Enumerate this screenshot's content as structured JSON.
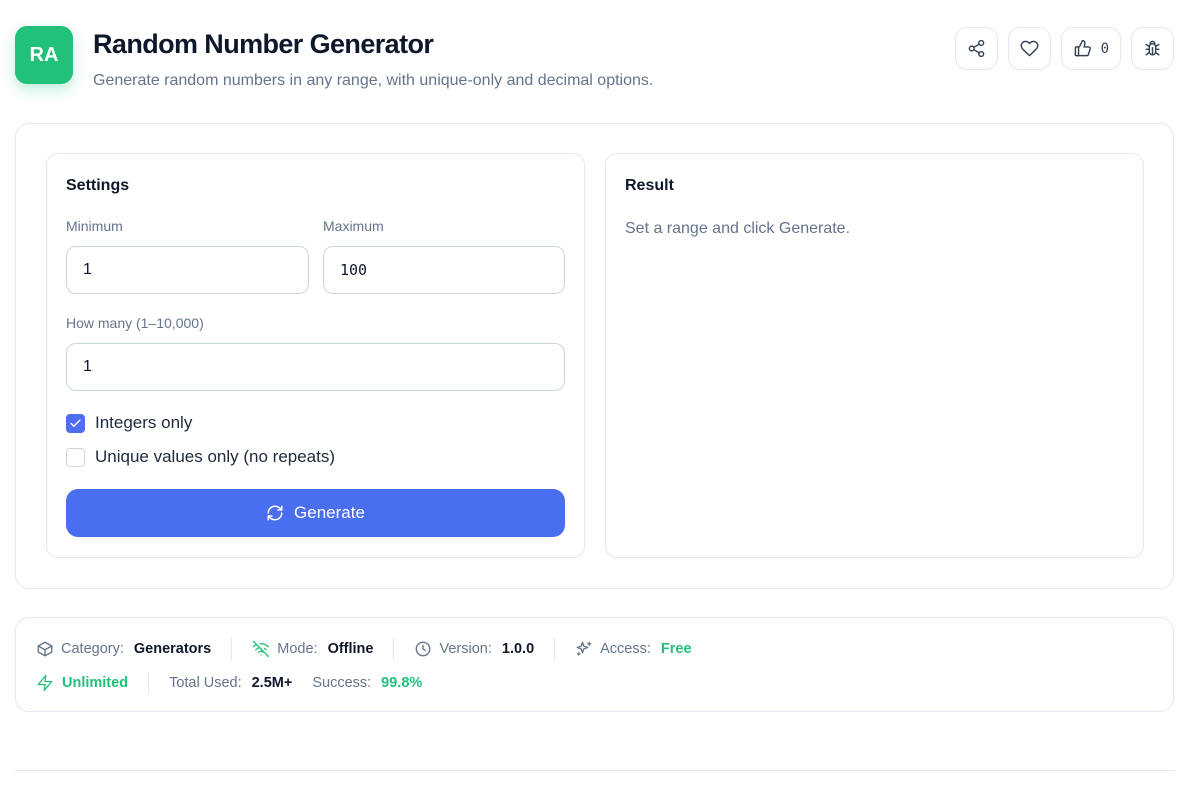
{
  "header": {
    "logo_text": "RA",
    "title": "Random Number Generator",
    "subtitle": "Generate random numbers in any range, with unique-only and decimal options."
  },
  "actions": {
    "share_icon": "share-icon",
    "favorite_icon": "heart-icon",
    "like_icon": "thumbs-up-icon",
    "like_count": "0",
    "report_icon": "bug-icon"
  },
  "settings": {
    "title": "Settings",
    "minimum_label": "Minimum",
    "minimum_value": "1",
    "maximum_label": "Maximum",
    "maximum_value": "100",
    "count_label": "How many (1–10,000)",
    "count_value": "1",
    "integers_label": "Integers only",
    "integers_checked": true,
    "unique_label": "Unique values only (no repeats)",
    "unique_checked": false,
    "generate_label": "Generate"
  },
  "result": {
    "title": "Result",
    "hint": "Set a range and click Generate."
  },
  "meta": {
    "category_label": "Category:",
    "category_value": "Generators",
    "mode_label": "Mode:",
    "mode_value": "Offline",
    "version_label": "Version:",
    "version_value": "1.0.0",
    "access_label": "Access:",
    "access_value": "Free",
    "limit_value": "Unlimited",
    "total_label": "Total Used:",
    "total_value": "2.5M+",
    "success_label": "Success:",
    "success_value": "99.8%"
  },
  "colors": {
    "brand_green": "#22c17a",
    "primary_blue": "#4a6ef0",
    "muted_text": "#64748b"
  }
}
